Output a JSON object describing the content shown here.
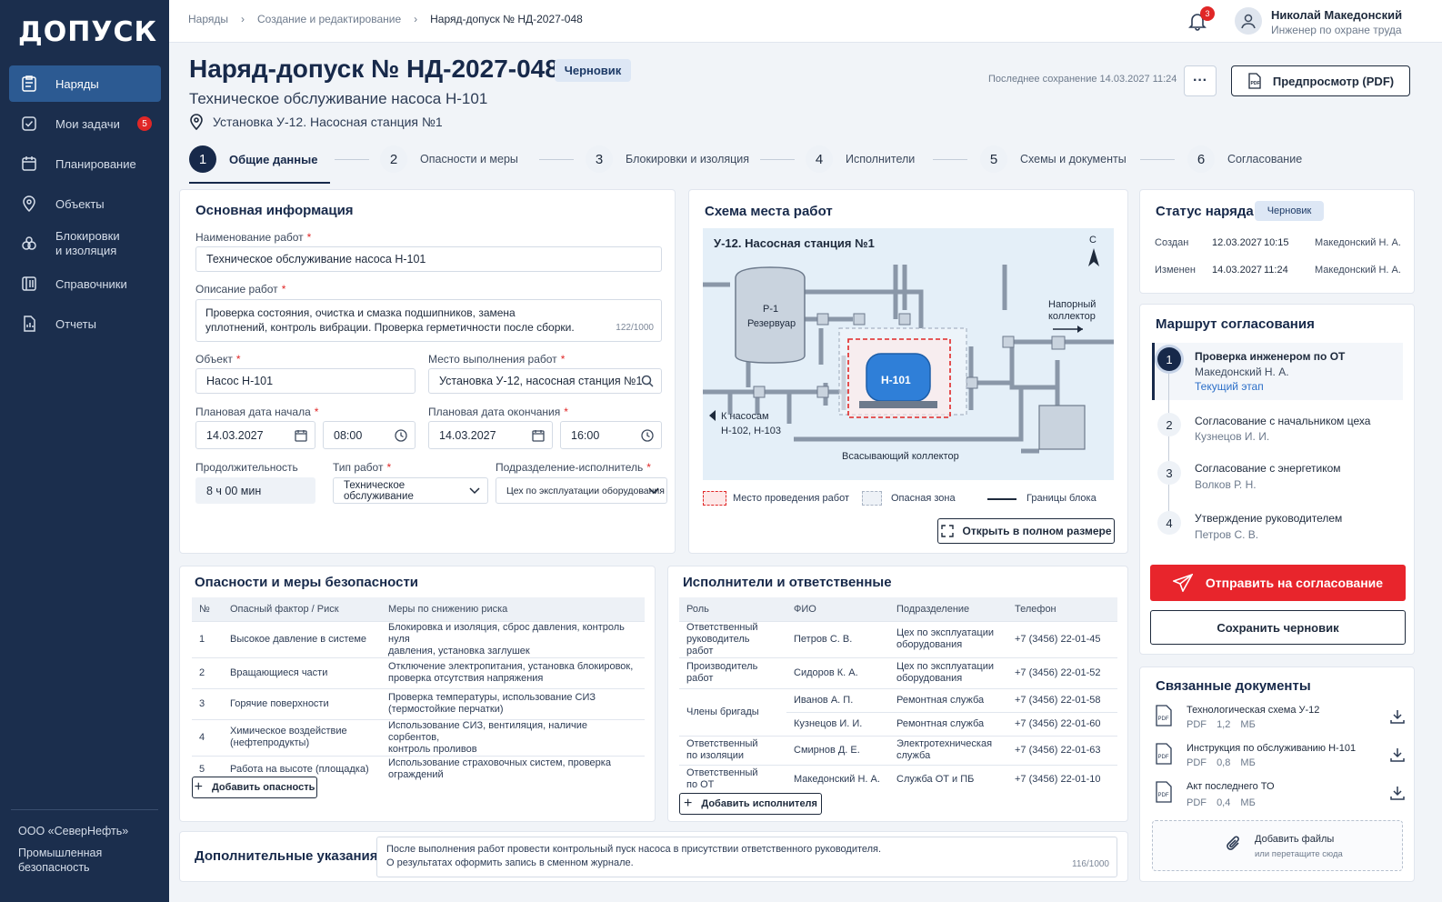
{
  "sidebar": {
    "logo": "ДОПУСК",
    "items": [
      {
        "label": "Наряды",
        "active": true
      },
      {
        "label": "Мои задачи",
        "badge": "5"
      },
      {
        "label": "Планирование"
      },
      {
        "label": "Объекты"
      },
      {
        "label": "Блокировки и изоляция",
        "line1": "Блокировки",
        "line2": "и изоляция"
      },
      {
        "label": "Справочники"
      },
      {
        "label": "Отчеты"
      }
    ],
    "org": "ООО «СеверНефть»",
    "module_line1": "Промышленная",
    "module_line2": "безопасность"
  },
  "topbar": {
    "breadcrumbs": [
      "Наряды",
      "Создание и редактирование",
      "Наряд-допуск № НД-2027-048"
    ],
    "notifications": "3",
    "user_name": "Николай Македонский",
    "user_role": "Инженер по охране труда"
  },
  "header": {
    "title": "Наряд-допуск № НД-2027-048",
    "status": "Черновик",
    "subtitle": "Техническое обслуживание насоса Н-101",
    "location": "Установка У-12. Насосная станция №1",
    "last_saved": "Последнее сохранение 14.03.2027 11:24",
    "more": "···",
    "preview_button": "Предпросмотр (PDF)"
  },
  "steps": [
    {
      "n": "1",
      "label": "Общие данные"
    },
    {
      "n": "2",
      "label": "Опасности и меры"
    },
    {
      "n": "3",
      "label": "Блокировки и изоляция"
    },
    {
      "n": "4",
      "label": "Исполнители"
    },
    {
      "n": "5",
      "label": "Схемы и документы"
    },
    {
      "n": "6",
      "label": "Согласование"
    }
  ],
  "basic": {
    "heading": "Основная информация",
    "work_name_label": "Наименование работ",
    "work_name": "Техническое обслуживание насоса Н-101",
    "desc_label": "Описание работ",
    "desc_line1": "Проверка состояния, очистка и смазка подшипников, замена",
    "desc_line2": "уплотнений, контроль вибрации. Проверка герметичности после сборки.",
    "desc_counter": "122/1000",
    "object_label": "Объект",
    "object": "Насос Н-101",
    "place_label": "Место выполнения работ",
    "place": "Установка У-12, насосная станция №1",
    "start_label": "Плановая дата начала",
    "start_date": "14.03.2027",
    "start_time": "08:00",
    "end_label": "Плановая дата окончания",
    "end_date": "14.03.2027",
    "end_time": "16:00",
    "duration_label": "Продолжительность",
    "duration": "8 ч 00 мин",
    "type_label": "Тип работ",
    "type": "Техническое обслуживание",
    "dept_label": "Подразделение-исполнитель",
    "dept": "Цех по эксплуатации оборудования"
  },
  "scheme": {
    "heading": "Схема места работ",
    "title": "У-12. Насосная станция №1",
    "north": "С",
    "tank1": "Р-1",
    "tank2": "Резервуар",
    "pump": "Н-101",
    "collector1": "Напорный",
    "collector2": "коллектор",
    "to_pumps1": "К насосам",
    "to_pumps2": "Н-102, Н-103",
    "suction": "Всасывающий коллектор",
    "legend": [
      "Место проведения работ",
      "Опасная зона",
      "Границы блока"
    ],
    "open_full": "Открыть в полном размере",
    "colors": {
      "work_area": "#e02727",
      "hazard": "#a9b4c4",
      "pipe": "#8a97a8",
      "pump": "#2f7fd8"
    }
  },
  "hazards": {
    "heading": "Опасности и меры безопасности",
    "columns": [
      "№",
      "Опасный фактор / Риск",
      "Меры по снижению риска"
    ],
    "rows": [
      {
        "n": "1",
        "risk": "Высокое давление в системе",
        "m1": "Блокировка и изоляция, сброс давления, контроль нуля",
        "m2": "давления, установка заглушек"
      },
      {
        "n": "2",
        "risk": "Вращающиеся части",
        "m1": "Отключение электропитания, установка блокировок,",
        "m2": "проверка отсутствия напряжения"
      },
      {
        "n": "3",
        "risk": "Горячие поверхности",
        "m1": "Проверка температуры, использование СИЗ",
        "m2": "(термостойкие перчатки)"
      },
      {
        "n": "4",
        "risk": "Химическое воздействие",
        "risk2": "(нефтепродукты)",
        "m1": "Использование СИЗ, вентиляция, наличие сорбентов,",
        "m2": "контроль проливов"
      },
      {
        "n": "5",
        "risk": "Работа на высоте (площадка)",
        "m1": "Использование страховочных систем, проверка ограждений",
        "m2": ""
      }
    ],
    "add": "Добавить опасность"
  },
  "executors": {
    "heading": "Исполнители и ответственные",
    "columns": [
      "Роль",
      "ФИО",
      "Подразделение",
      "Телефон"
    ],
    "rows": [
      {
        "r1": "Ответственный",
        "r2": "руководитель работ",
        "name": "Петров С. В.",
        "d1": "Цех по эксплуатации",
        "d2": "оборудования",
        "phone": "+7 (3456) 22-01-45"
      },
      {
        "r1": "Производитель работ",
        "r2": "",
        "name": "Сидоров К. А.",
        "d1": "Цех по эксплуатации",
        "d2": "оборудования",
        "phone": "+7 (3456) 22-01-52"
      },
      {
        "r1": "Члены бригады",
        "r2": "",
        "name": "Иванов А. П.",
        "d1": "Ремонтная служба",
        "d2": "",
        "phone": "+7 (3456) 22-01-58"
      },
      {
        "r1": "",
        "r2": "",
        "name": "Кузнецов И. И.",
        "d1": "Ремонтная служба",
        "d2": "",
        "phone": "+7 (3456) 22-01-60"
      },
      {
        "r1": "Ответственный",
        "r2": "по изоляции",
        "name": "Смирнов Д. Е.",
        "d1": "Электротехническая",
        "d2": "служба",
        "phone": "+7 (3456) 22-01-63"
      },
      {
        "r1": "Ответственный",
        "r2": "по ОТ",
        "name": "Македонский Н. А.",
        "d1": "Служба ОТ и ПБ",
        "d2": "",
        "phone": "+7 (3456) 22-01-10"
      }
    ],
    "add": "Добавить исполнителя"
  },
  "additional": {
    "heading": "Дополнительные указания",
    "line1": "После выполнения работ провести контрольный пуск насоса в присутствии ответственного руководителя.",
    "line2": "О результатах оформить запись в сменном журнале.",
    "counter": "116/1000"
  },
  "status_card": {
    "heading": "Статус наряда",
    "status": "Черновик",
    "rows": [
      {
        "label": "Создан",
        "date": "12.03.2027",
        "time": "10:15",
        "who": "Македонский Н. А."
      },
      {
        "label": "Изменен",
        "date": "14.03.2027",
        "time": "11:24",
        "who": "Македонский Н. А."
      }
    ]
  },
  "route": {
    "heading": "Маршрут согласования",
    "items": [
      {
        "n": "1",
        "title": "Проверка инженером по ОТ",
        "person": "Македонский Н. А.",
        "note": "Текущий этап"
      },
      {
        "n": "2",
        "title": "Согласование с начальником цеха",
        "person": "Кузнецов И. И."
      },
      {
        "n": "3",
        "title": "Согласование с энергетиком",
        "person": "Волков Р. Н."
      },
      {
        "n": "4",
        "title": "Утверждение руководителем",
        "person": "Петров С. В."
      }
    ],
    "send": "Отправить на согласование",
    "save": "Сохранить черновик"
  },
  "docs": {
    "heading": "Связанные документы",
    "items": [
      {
        "name": "Технологическая схема У-12",
        "type": "PDF",
        "size": "1,2 МБ"
      },
      {
        "name": "Инструкция по обслуживанию Н-101",
        "type": "PDF",
        "size": "0,8 МБ"
      },
      {
        "name": "Акт последнего ТО",
        "type": "PDF",
        "size": "0,4 МБ"
      }
    ],
    "attach": "Добавить файлы",
    "attach_hint": "или перетащите сюда"
  }
}
